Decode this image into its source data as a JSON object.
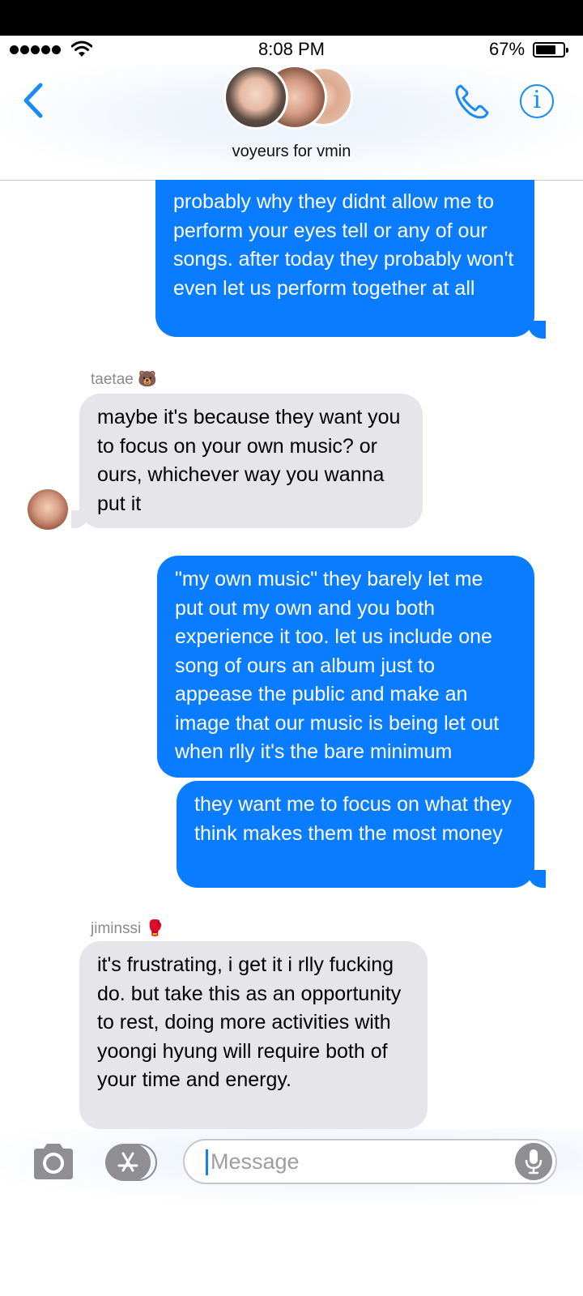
{
  "status_bar": {
    "time": "8:08 PM",
    "battery": "67%"
  },
  "header": {
    "group_name": "voyeurs for vmin"
  },
  "messages": [
    {
      "dir": "out",
      "text": "probably why they didnt allow me to perform your eyes tell or any of our songs. after today they probably won't even let us perform together at all"
    },
    {
      "dir": "in",
      "sender": "taetae 🐻",
      "text": "maybe it's because they want you to focus on your own music? or ours, whichever way you wanna put it"
    },
    {
      "dir": "out",
      "text": "\"my own music\" they barely let me put out my own and you both experience it too. let us include one song of ours an album just to appease the public and make an image that our music is being let out when rlly it's the bare minimum"
    },
    {
      "dir": "out",
      "text": "they want me to focus on what they think makes them the most money"
    },
    {
      "dir": "in",
      "sender": "jiminssi 🥊",
      "text": "it's frustrating, i get it i rlly fucking do. but take this as an opportunity to rest, doing more activities with yoongi hyung will require both of your time and energy."
    }
  ],
  "composer": {
    "placeholder": "Message"
  },
  "colors": {
    "accent": "#0a7cff",
    "incoming": "#e5e5ea",
    "icon_blue": "#1a8cf0"
  },
  "icons": [
    "back-chevron-icon",
    "phone-icon",
    "info-icon",
    "camera-icon",
    "app-store-icon",
    "microphone-icon"
  ]
}
